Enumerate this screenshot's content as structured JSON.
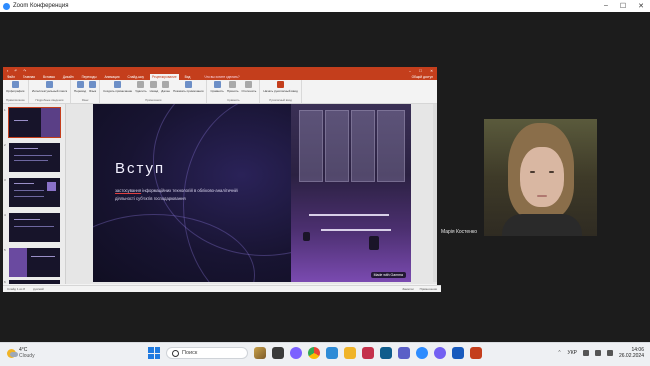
{
  "zoom": {
    "window_title": "Zoom Конференция",
    "controls": [
      "–",
      "☐",
      "✕"
    ]
  },
  "powerpoint": {
    "tabs": [
      "Файл",
      "Главная",
      "Вставка",
      "Дизайн",
      "Переходы",
      "Анимация",
      "Слайд-шоу",
      "Рецензирование",
      "Вид"
    ],
    "active_tab": "Рецензирование",
    "tell_me": "Что вы хотите сделать?",
    "share": "Общий доступ",
    "ribbon_groups": [
      {
        "label": "Правописание",
        "buttons": [
          "Орфография"
        ]
      },
      {
        "label": "Подробные сведения",
        "buttons": [
          "Интеллектуальный поиск"
        ]
      },
      {
        "label": "Язык",
        "buttons": [
          "Перевод",
          "Язык"
        ]
      },
      {
        "label": "Примечания",
        "buttons": [
          "Создать примечание",
          "Удалить",
          "Назад",
          "Далее",
          "Показать примечания"
        ]
      },
      {
        "label": "Сравнить",
        "buttons": [
          "Сравнить",
          "Принять",
          "Отклонить"
        ]
      },
      {
        "label": "Рукописный ввод",
        "buttons": [
          "Начать рукописный ввод"
        ]
      }
    ],
    "slide": {
      "title": "Вступ",
      "subtitle_underlined": "застосування",
      "subtitle_rest": " інформаційних технологій в обліково-аналітичній",
      "subtitle_line2": "діяльності суб'єктів господарювання",
      "badge": "Made with Gamma"
    },
    "thumbnail_numbers": [
      "1",
      "2",
      "3",
      "4",
      "5",
      "6"
    ],
    "status": {
      "slide_counter": "Слайд 1 из 8",
      "language": "русский",
      "notes": "Заметки",
      "comments": "Примечания"
    }
  },
  "participant": {
    "name": "Марія Костенко"
  },
  "taskbar": {
    "weather_temp": "4°C",
    "weather_cond": "Cloudy",
    "search_placeholder": "Поиск",
    "lang": "УКР",
    "time": "14:06",
    "date": "26.02.2024"
  },
  "colors": {
    "ppt_accent": "#c43e1c",
    "slide_bg": "#14122a",
    "taskbar_bg": "#eef0f3"
  }
}
